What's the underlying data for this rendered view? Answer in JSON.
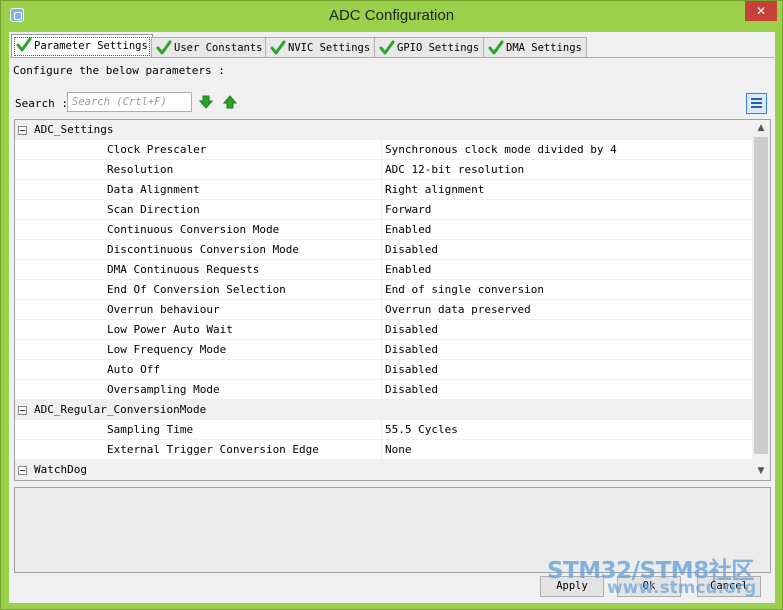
{
  "window": {
    "title": "ADC Configuration",
    "close_label": "✕"
  },
  "tabs": [
    {
      "label": "Parameter Settings",
      "active": true
    },
    {
      "label": "User Constants"
    },
    {
      "label": "NVIC Settings"
    },
    {
      "label": "GPIO Settings"
    },
    {
      "label": "DMA Settings"
    }
  ],
  "instruction": "Configure the below parameters :",
  "search": {
    "label": "Search :",
    "placeholder": "Search (Crtl+F)"
  },
  "groups": [
    {
      "name": "ADC_Settings",
      "params": [
        {
          "name": "Clock Prescaler",
          "value": "Synchronous clock mode divided by 4"
        },
        {
          "name": "Resolution",
          "value": "ADC 12-bit resolution"
        },
        {
          "name": "Data Alignment",
          "value": "Right alignment"
        },
        {
          "name": "Scan Direction",
          "value": "Forward"
        },
        {
          "name": "Continuous Conversion Mode",
          "value": "Enabled"
        },
        {
          "name": "Discontinuous Conversion Mode",
          "value": "Disabled"
        },
        {
          "name": "DMA Continuous Requests",
          "value": "Enabled"
        },
        {
          "name": "End Of Conversion Selection",
          "value": "End of single conversion"
        },
        {
          "name": "Overrun behaviour",
          "value": "Overrun data preserved"
        },
        {
          "name": "Low Power Auto Wait",
          "value": "Disabled"
        },
        {
          "name": "Low Frequency Mode",
          "value": "Disabled"
        },
        {
          "name": "Auto Off",
          "value": "Disabled"
        },
        {
          "name": "Oversampling Mode",
          "value": "Disabled"
        }
      ]
    },
    {
      "name": "ADC_Regular_ConversionMode",
      "params": [
        {
          "name": "Sampling Time",
          "value": "55.5 Cycles"
        },
        {
          "name": "External Trigger Conversion Edge",
          "value": "None"
        }
      ]
    },
    {
      "name": "WatchDog",
      "params": []
    }
  ],
  "buttons": {
    "apply": "Apply",
    "ok": "Ok",
    "cancel": "Cancel"
  },
  "watermark": {
    "line1": "STM32/STM8社区",
    "line2": "www.stmcu.org"
  },
  "colors": {
    "frame": "#9bd04a",
    "close": "#c7403a",
    "check": "#2aa52a",
    "arrow": "#2aa52a"
  }
}
